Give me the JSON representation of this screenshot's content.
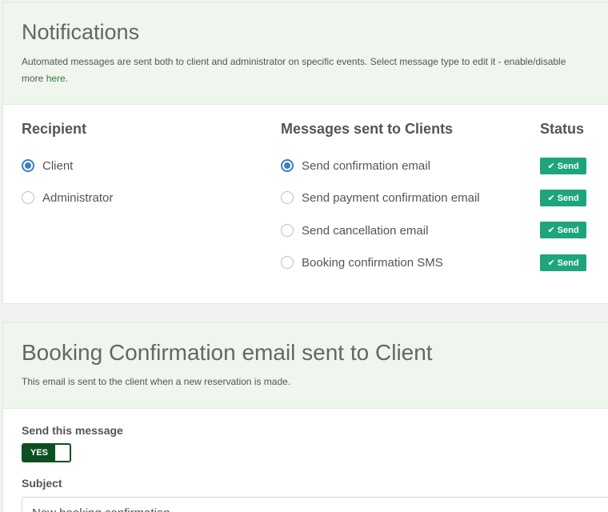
{
  "notifications": {
    "title": "Notifications",
    "description_line1": "Automated messages are sent both to client and administrator on specific events. Select message type to edit it - enable/disable",
    "description_line2_prefix": "more ",
    "description_link": "here",
    "description_line2_suffix": "."
  },
  "recipient": {
    "heading": "Recipient",
    "options": [
      {
        "label": "Client",
        "checked": true
      },
      {
        "label": "Administrator",
        "checked": false
      }
    ]
  },
  "messages": {
    "heading": "Messages sent to Clients",
    "options": [
      {
        "label": "Send confirmation email",
        "checked": true
      },
      {
        "label": "Send payment confirmation email",
        "checked": false
      },
      {
        "label": "Send cancellation email",
        "checked": false
      },
      {
        "label": "Booking confirmation SMS",
        "checked": false
      }
    ]
  },
  "status": {
    "heading": "Status",
    "badges": [
      "Send",
      "Send",
      "Send",
      "Send"
    ],
    "color": "#1ea57c"
  },
  "editor": {
    "title": "Booking Confirmation email sent to Client",
    "description": "This email is sent to the client when a new reservation is made.",
    "send_label": "Send this message",
    "toggle_label": "YES",
    "toggle_color": "#0d4f20",
    "subject_label": "Subject",
    "subject_value": "New booking confirmation"
  },
  "icons": {
    "check": "check-icon"
  }
}
